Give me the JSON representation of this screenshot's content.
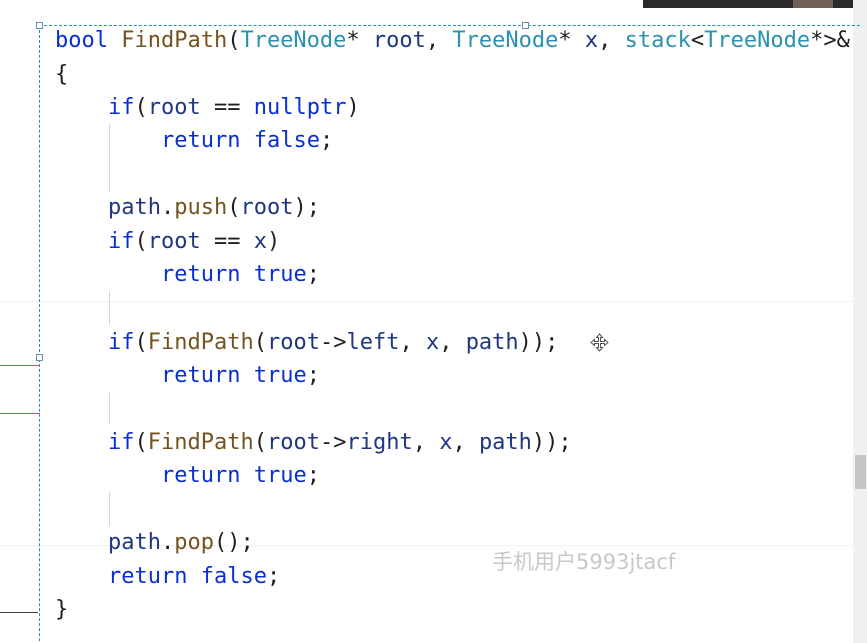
{
  "editor": {
    "lines": [
      [
        [
          "kw",
          "bool"
        ],
        [
          "plain",
          " "
        ],
        [
          "fn",
          "FindPath"
        ],
        [
          "plain",
          "("
        ],
        [
          "ty",
          "TreeNode"
        ],
        [
          "plain",
          "* "
        ],
        [
          "ident",
          "root"
        ],
        [
          "plain",
          ", "
        ],
        [
          "ty",
          "TreeNode"
        ],
        [
          "plain",
          "* "
        ],
        [
          "ident",
          "x"
        ],
        [
          "plain",
          ", "
        ],
        [
          "ty",
          "stack"
        ],
        [
          "plain",
          "<"
        ],
        [
          "ty",
          "TreeNode"
        ],
        [
          "plain",
          "*>&"
        ]
      ],
      [
        [
          "plain",
          "{"
        ]
      ],
      [
        [
          "kw",
          "if"
        ],
        [
          "plain",
          "("
        ],
        [
          "ident",
          "root"
        ],
        [
          "plain",
          " == "
        ],
        [
          "kw",
          "nullptr"
        ],
        [
          "plain",
          ")"
        ]
      ],
      [
        [
          "kw",
          "return"
        ],
        [
          "plain",
          " "
        ],
        [
          "kw",
          "false"
        ],
        [
          "plain",
          ";"
        ]
      ],
      [],
      [
        [
          "ident",
          "path"
        ],
        [
          "plain",
          "."
        ],
        [
          "fn",
          "push"
        ],
        [
          "plain",
          "("
        ],
        [
          "ident",
          "root"
        ],
        [
          "plain",
          ");"
        ]
      ],
      [
        [
          "kw",
          "if"
        ],
        [
          "plain",
          "("
        ],
        [
          "ident",
          "root"
        ],
        [
          "plain",
          " == "
        ],
        [
          "ident",
          "x"
        ],
        [
          "plain",
          ")"
        ]
      ],
      [
        [
          "kw",
          "return"
        ],
        [
          "plain",
          " "
        ],
        [
          "kw",
          "true"
        ],
        [
          "plain",
          ";"
        ]
      ],
      [],
      [
        [
          "kw",
          "if"
        ],
        [
          "plain",
          "("
        ],
        [
          "fn",
          "FindPath"
        ],
        [
          "plain",
          "("
        ],
        [
          "ident",
          "root"
        ],
        [
          "plain",
          "->"
        ],
        [
          "ident",
          "left"
        ],
        [
          "plain",
          ", "
        ],
        [
          "ident",
          "x"
        ],
        [
          "plain",
          ", "
        ],
        [
          "ident",
          "path"
        ],
        [
          "plain",
          "));"
        ]
      ],
      [
        [
          "kw",
          "return"
        ],
        [
          "plain",
          " "
        ],
        [
          "kw",
          "true"
        ],
        [
          "plain",
          ";"
        ]
      ],
      [],
      [
        [
          "kw",
          "if"
        ],
        [
          "plain",
          "("
        ],
        [
          "fn",
          "FindPath"
        ],
        [
          "plain",
          "("
        ],
        [
          "ident",
          "root"
        ],
        [
          "plain",
          "->"
        ],
        [
          "ident",
          "right"
        ],
        [
          "plain",
          ", "
        ],
        [
          "ident",
          "x"
        ],
        [
          "plain",
          ", "
        ],
        [
          "ident",
          "path"
        ],
        [
          "plain",
          "));"
        ]
      ],
      [
        [
          "kw",
          "return"
        ],
        [
          "plain",
          " "
        ],
        [
          "kw",
          "true"
        ],
        [
          "plain",
          ";"
        ]
      ],
      [],
      [
        [
          "ident",
          "path"
        ],
        [
          "plain",
          "."
        ],
        [
          "fn",
          "pop"
        ],
        [
          "plain",
          "();"
        ]
      ],
      [
        [
          "kw",
          "return"
        ],
        [
          "plain",
          " "
        ],
        [
          "kw",
          "false"
        ],
        [
          "plain",
          ";"
        ]
      ],
      [
        [
          "plain",
          "}"
        ]
      ]
    ]
  },
  "watermark": "手机用户5993jtacf",
  "icons": {
    "move_cursor": "move-cursor-icon"
  },
  "colors": {
    "keyword": "#0a2fd0",
    "type": "#2b91af",
    "function": "#74531f",
    "identifier": "#1f377f",
    "plain": "#1e1e1e",
    "frame": "#1f8fc0"
  }
}
